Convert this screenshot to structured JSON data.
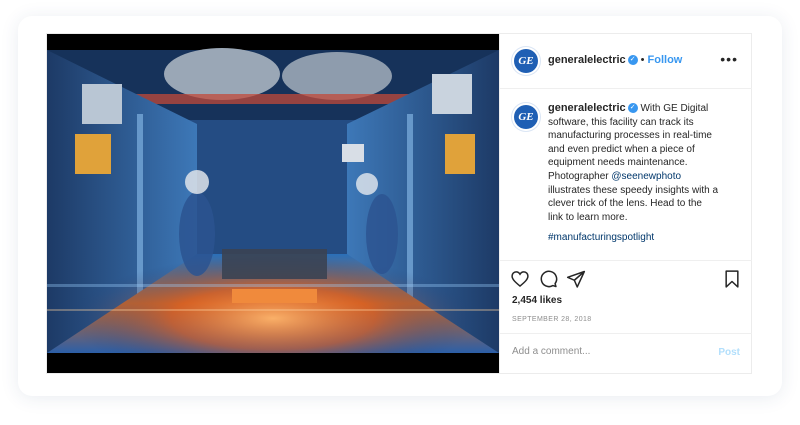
{
  "post": {
    "username": "generalelectric",
    "follow_label": "Follow",
    "separator": "•",
    "more_glyph": "•••",
    "avatar_monogram": "GE",
    "verified_glyph": "✓",
    "caption_lines": [
      "With GE Digital",
      "software, this facility can track its",
      "manufacturing processes in real-time",
      "and even predict when a piece of",
      "equipment needs maintenance.",
      "Photographer",
      "illustrates these speedy insights with a",
      "clever trick of the lens. Head to the",
      "link to learn more."
    ],
    "mention": "@seenewphoto",
    "hashtag": "#manufacturingspotlight",
    "likes": "2,454 likes",
    "date": "SEPTEMBER 28, 2018",
    "comment_placeholder": "Add a comment...",
    "post_label": "Post"
  },
  "icons": {
    "like": "heart-icon",
    "comment": "comment-icon",
    "share": "share-icon",
    "save": "bookmark-icon",
    "verified": "verified-badge-icon"
  },
  "colors": {
    "link_blue": "#3897f0",
    "mention_blue": "#00376b",
    "ge_blue": "#1f5fb4",
    "post_disabled": "#b2dffc"
  }
}
